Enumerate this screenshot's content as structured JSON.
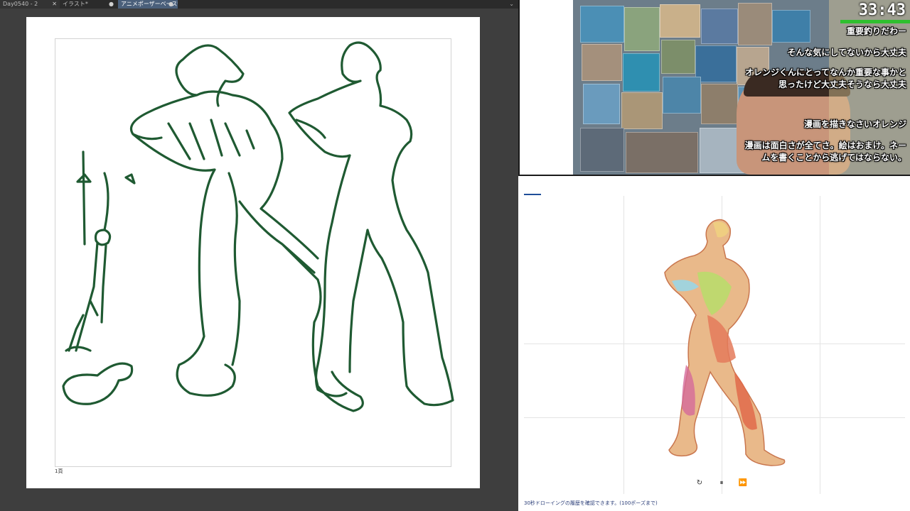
{
  "app": {
    "tabs": [
      {
        "label": "Day0540 - 2",
        "active": false
      },
      {
        "label": "イラスト*",
        "active": false
      },
      {
        "label": "アニメポーザーベース*",
        "active": true
      }
    ],
    "page_number": "1頁"
  },
  "stream": {
    "timer": "33:43",
    "comments": [
      "重要釣りだわー",
      "そんな気にしてないから大丈夫",
      "オレンジくんにとってなんか重要な事かと思ったけど大丈夫そうなら大丈夫",
      "漫画を描きなさいオレンジ",
      "漫画は面白さが全てさ。絵はおまけ。ネームを書くことから逃げてはならない。"
    ]
  },
  "viewer": {
    "caption": "30秒ドローイングの履歴を確認できます。(100ポーズまで)",
    "controls": {
      "reset": "↻",
      "pause": "⏸",
      "forward": "⏩"
    }
  },
  "colors": {
    "sketch_stroke": "#1f5a32",
    "timer_bar": "#2fbf2f",
    "active_tab": "#4a5f7a"
  }
}
